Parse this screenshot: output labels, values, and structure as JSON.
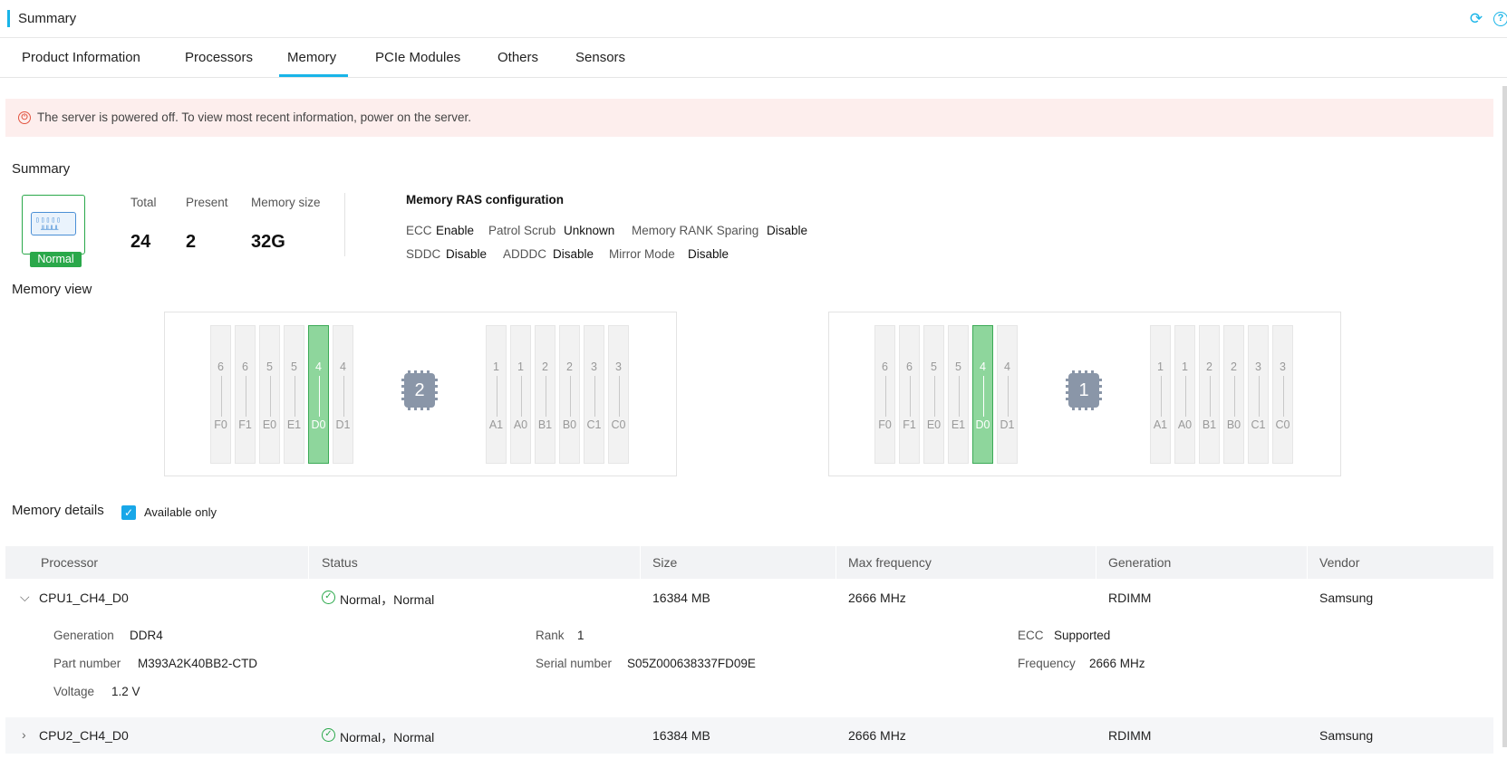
{
  "header": {
    "title": "Summary"
  },
  "tabs": [
    {
      "label": "Product Information"
    },
    {
      "label": "Processors"
    },
    {
      "label": "Memory"
    },
    {
      "label": "PCIe Modules"
    },
    {
      "label": "Others"
    },
    {
      "label": "Sensors"
    }
  ],
  "active_tab": "Memory",
  "alert": {
    "message": "The server is powered off. To view most recent information, power on the server."
  },
  "summary": {
    "title": "Summary",
    "status_badge": "Normal",
    "stats": [
      {
        "label": "Total",
        "value": "24"
      },
      {
        "label": "Present",
        "value": "2"
      },
      {
        "label": "Memory size",
        "value": "32G"
      }
    ],
    "ras": {
      "title": "Memory RAS configuration",
      "items": [
        {
          "key": "ECC",
          "value": "Enable"
        },
        {
          "key": "Patrol Scrub",
          "value": "Unknown"
        },
        {
          "key": "Memory RANK Sparing",
          "value": "Disable"
        },
        {
          "key": "SDDC",
          "value": "Disable"
        },
        {
          "key": "ADDDC",
          "value": "Disable"
        },
        {
          "key": "Mirror Mode",
          "value": "Disable"
        }
      ]
    }
  },
  "memory_view": {
    "title": "Memory view",
    "panels": [
      {
        "cpu": "2",
        "left_slots": [
          {
            "num": "6",
            "name": "F0",
            "present": false
          },
          {
            "num": "6",
            "name": "F1",
            "present": false
          },
          {
            "num": "5",
            "name": "E0",
            "present": false
          },
          {
            "num": "5",
            "name": "E1",
            "present": false
          },
          {
            "num": "4",
            "name": "D0",
            "present": true
          },
          {
            "num": "4",
            "name": "D1",
            "present": false
          }
        ],
        "right_slots": [
          {
            "num": "1",
            "name": "A1",
            "present": false
          },
          {
            "num": "1",
            "name": "A0",
            "present": false
          },
          {
            "num": "2",
            "name": "B1",
            "present": false
          },
          {
            "num": "2",
            "name": "B0",
            "present": false
          },
          {
            "num": "3",
            "name": "C1",
            "present": false
          },
          {
            "num": "3",
            "name": "C0",
            "present": false
          }
        ]
      },
      {
        "cpu": "1",
        "left_slots": [
          {
            "num": "6",
            "name": "F0",
            "present": false
          },
          {
            "num": "6",
            "name": "F1",
            "present": false
          },
          {
            "num": "5",
            "name": "E0",
            "present": false
          },
          {
            "num": "5",
            "name": "E1",
            "present": false
          },
          {
            "num": "4",
            "name": "D0",
            "present": true
          },
          {
            "num": "4",
            "name": "D1",
            "present": false
          }
        ],
        "right_slots": [
          {
            "num": "1",
            "name": "A1",
            "present": false
          },
          {
            "num": "1",
            "name": "A0",
            "present": false
          },
          {
            "num": "2",
            "name": "B1",
            "present": false
          },
          {
            "num": "2",
            "name": "B0",
            "present": false
          },
          {
            "num": "3",
            "name": "C1",
            "present": false
          },
          {
            "num": "3",
            "name": "C0",
            "present": false
          }
        ]
      }
    ]
  },
  "details": {
    "title": "Memory details",
    "available_only_label": "Available only",
    "available_only_checked": true,
    "columns": [
      "Processor",
      "Status",
      "Size",
      "Max frequency",
      "Generation",
      "Vendor"
    ],
    "rows": [
      {
        "processor": "CPU1_CH4_D0",
        "status": "Normal，Normal",
        "size": "16384 MB",
        "max_frequency": "2666 MHz",
        "generation": "RDIMM",
        "vendor": "Samsung",
        "expanded": true,
        "detail": {
          "generation_label": "Generation",
          "generation": "DDR4",
          "rank_label": "Rank",
          "rank": "1",
          "ecc_label": "ECC",
          "ecc": "Supported",
          "part_number_label": "Part number",
          "part_number": "M393A2K40BB2-CTD",
          "serial_number_label": "Serial number",
          "serial_number": "S05Z000638337FD09E",
          "frequency_label": "Frequency",
          "frequency": "2666 MHz",
          "voltage_label": "Voltage",
          "voltage": "1.2 V"
        }
      },
      {
        "processor": "CPU2_CH4_D0",
        "status": "Normal，Normal",
        "size": "16384 MB",
        "max_frequency": "2666 MHz",
        "generation": "RDIMM",
        "vendor": "Samsung",
        "expanded": false
      }
    ]
  }
}
